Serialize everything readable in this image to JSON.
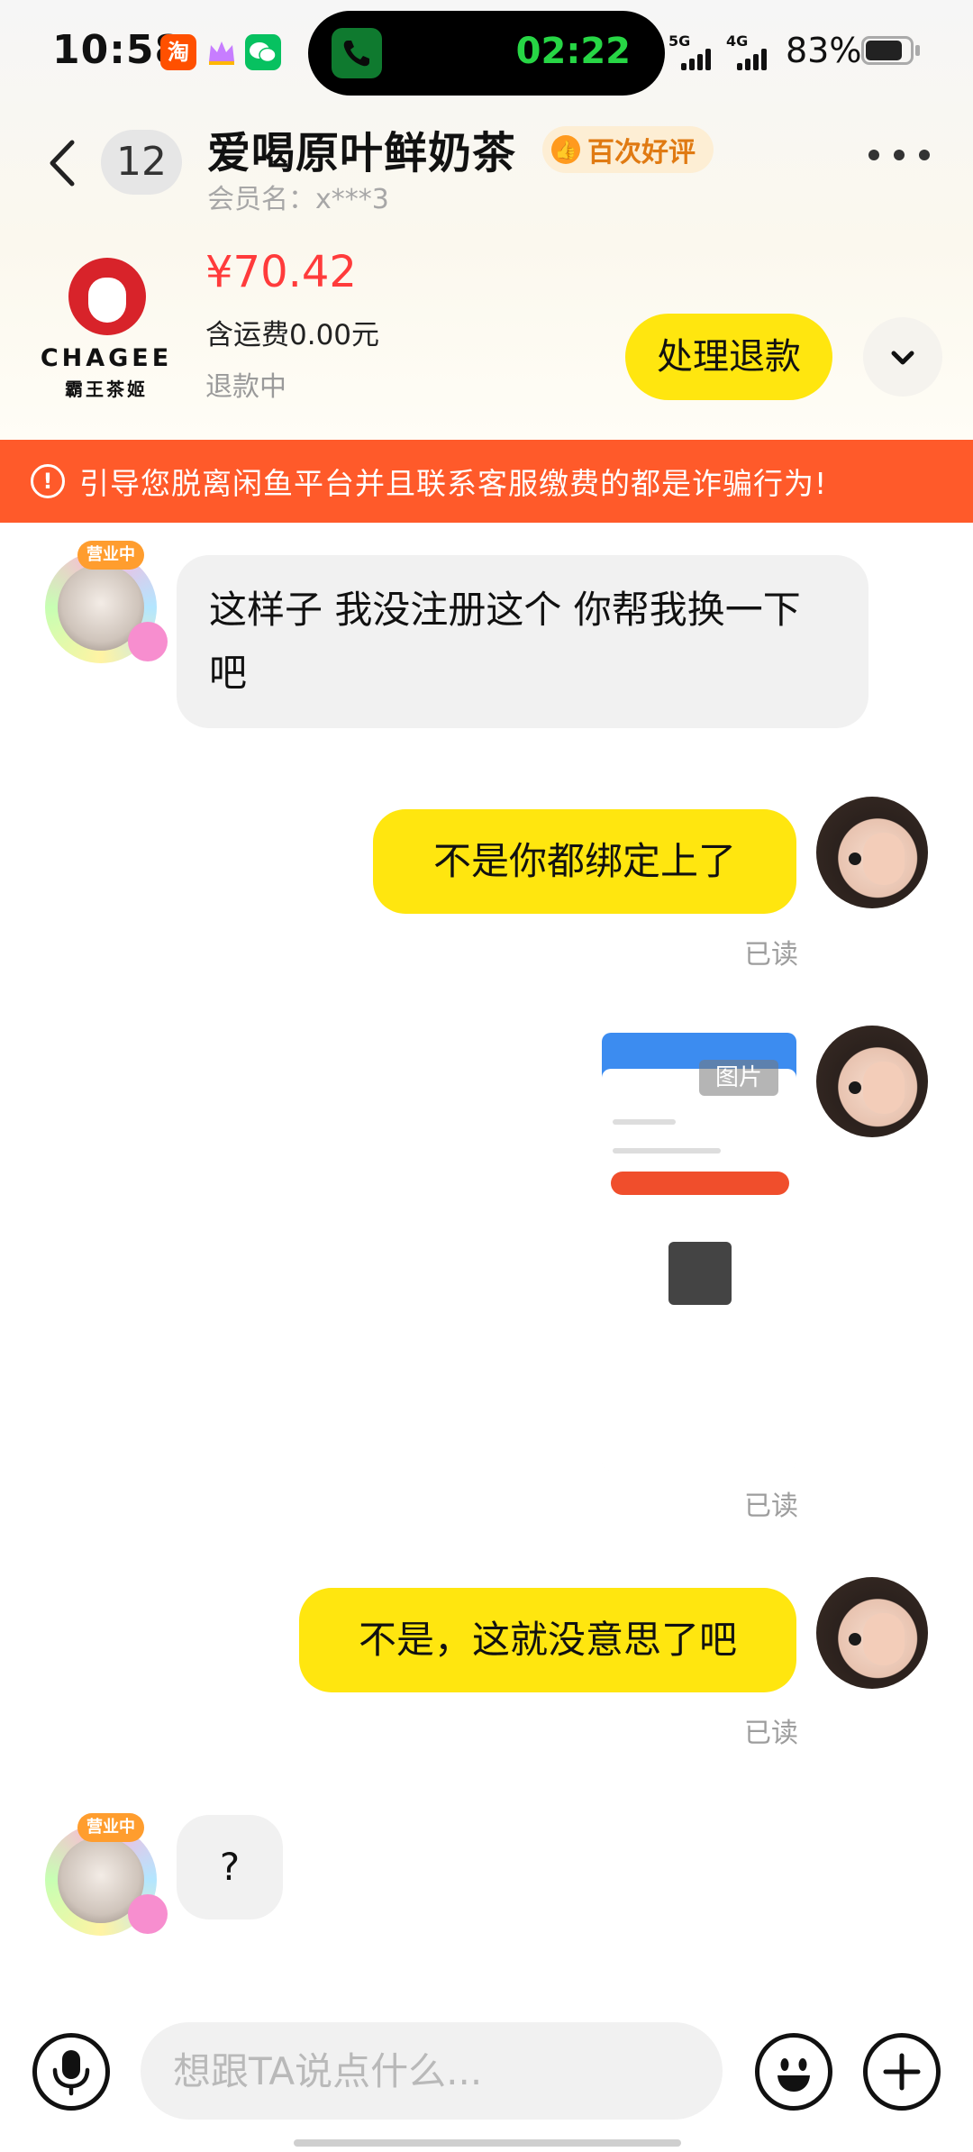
{
  "status_bar": {
    "time": "10:58",
    "apps": [
      "taobao-icon",
      "crown-icon",
      "wechat-icon"
    ],
    "call_timer": "02:22",
    "network_1": "5G",
    "network_2": "4G",
    "battery_percent": "83%",
    "battery_level": 0.83
  },
  "header": {
    "unread_count": "12",
    "shop_name": "爱喝原叶鲜奶茶",
    "rating_badge": "百次好评",
    "member_name": "会员名：x***3"
  },
  "order": {
    "brand_word": "CHAGEE",
    "brand_sub": "霸王茶姬",
    "price": "¥70.42",
    "shipping": "含运费0.00元",
    "status": "退款中",
    "action_label": "处理退款"
  },
  "warning": {
    "icon_text": "!",
    "text": "引导您脱离闲鱼平台并且联系客服缴费的都是诈骗行为!"
  },
  "avatar_them": {
    "tag": "营业中"
  },
  "messages": [
    {
      "sender": "them",
      "text": "这样子 我没注册这个 你帮我换一下吧"
    },
    {
      "sender": "me",
      "text": "不是你都绑定上了",
      "read": "已读"
    },
    {
      "sender": "me",
      "type": "image",
      "image_tag": "图片",
      "read": "已读"
    },
    {
      "sender": "me",
      "text": "不是，这就没意思了吧",
      "read": "已读"
    },
    {
      "sender": "them",
      "text": "?"
    }
  ],
  "input": {
    "placeholder": "想跟TA说点什么..."
  },
  "colors": {
    "accent_yellow": "#ffe60f",
    "warning_orange": "#ff5a2a",
    "price_red": "#ff3b3b",
    "call_green": "#27d645"
  }
}
